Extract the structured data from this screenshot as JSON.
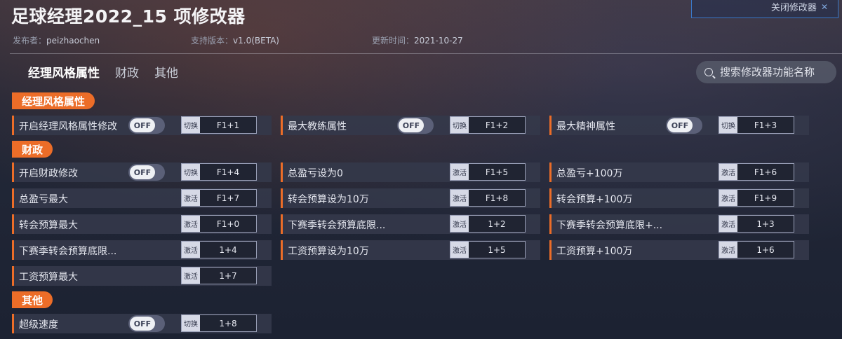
{
  "title": "足球经理2022_15 项修改器",
  "close_button": {
    "label": "关闭修改器",
    "icon": "close-icon"
  },
  "meta": {
    "author_label": "发布者：",
    "author": "peizhaochen",
    "version_label": "支持版本：",
    "version": "v1.0(BETA)",
    "updated_label": "更新时间：",
    "updated": "2021-10-27"
  },
  "tabs": [
    {
      "label": "经理风格属性",
      "active": true
    },
    {
      "label": "财政",
      "active": false
    },
    {
      "label": "其他",
      "active": false
    }
  ],
  "search": {
    "placeholder": "搜索修改器功能名称",
    "icon": "search-icon"
  },
  "sections": {
    "manager": {
      "label": "经理风格属性"
    },
    "finance": {
      "label": "财政"
    },
    "other": {
      "label": "其他"
    }
  },
  "toggle_off": "OFF",
  "action_switch": "切换",
  "action_activate": "激活",
  "rows": [
    {
      "label": "开启经理风格属性修改",
      "has_toggle": true,
      "action": "切换",
      "key": "F1+1"
    },
    {
      "label": "最大教练属性",
      "has_toggle": true,
      "action": "切换",
      "key": "F1+2"
    },
    {
      "label": "最大精神属性",
      "has_toggle": true,
      "action": "切换",
      "key": "F1+3"
    },
    {
      "label": "开启财政修改",
      "has_toggle": true,
      "action": "切换",
      "key": "F1+4"
    },
    {
      "label": "总盈亏设为0",
      "has_toggle": false,
      "action": "激活",
      "key": "F1+5"
    },
    {
      "label": "总盈亏+100万",
      "has_toggle": false,
      "action": "激活",
      "key": "F1+6"
    },
    {
      "label": "总盈亏最大",
      "has_toggle": false,
      "action": "激活",
      "key": "F1+7"
    },
    {
      "label": "转会预算设为10万",
      "has_toggle": false,
      "action": "激活",
      "key": "F1+8"
    },
    {
      "label": "转会预算+100万",
      "has_toggle": false,
      "action": "激活",
      "key": "F1+9"
    },
    {
      "label": "转会预算最大",
      "has_toggle": false,
      "action": "激活",
      "key": "F1+0"
    },
    {
      "label": "下赛季转会预算底限...",
      "has_toggle": false,
      "action": "激活",
      "key": "1+2"
    },
    {
      "label": "下赛季转会预算底限+...",
      "has_toggle": false,
      "action": "激活",
      "key": "1+3"
    },
    {
      "label": "下赛季转会预算底限...",
      "has_toggle": false,
      "action": "激活",
      "key": "1+4"
    },
    {
      "label": "工资预算设为10万",
      "has_toggle": false,
      "action": "激活",
      "key": "1+5"
    },
    {
      "label": "工资预算+100万",
      "has_toggle": false,
      "action": "激活",
      "key": "1+6"
    },
    {
      "label": "工资预算最大",
      "has_toggle": false,
      "action": "激活",
      "key": "1+7"
    },
    {
      "label": "超级速度",
      "has_toggle": true,
      "action": "切换",
      "key": "1+8"
    }
  ]
}
